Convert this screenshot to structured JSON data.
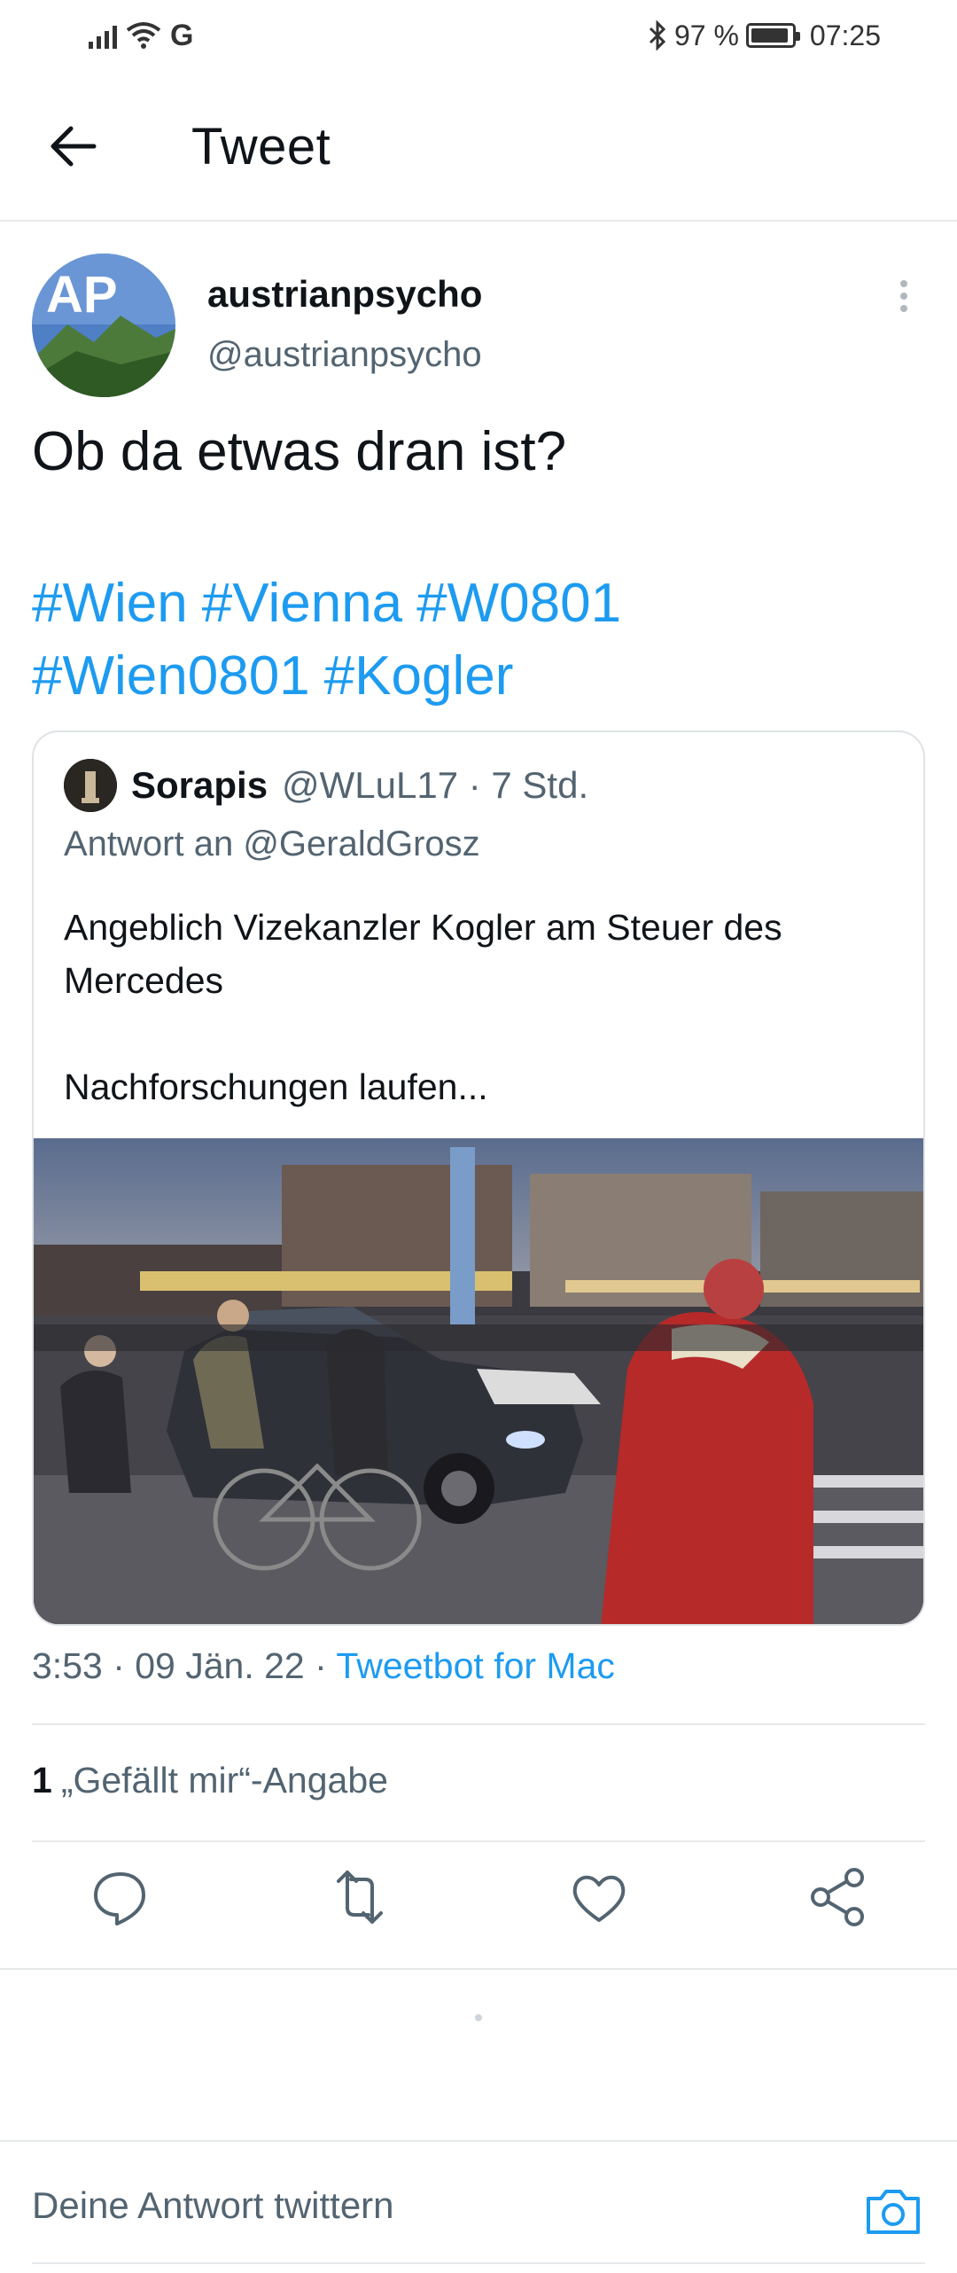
{
  "status_bar": {
    "network": "G",
    "battery_text": "97 %",
    "time": "07:25"
  },
  "header": {
    "title": "Tweet"
  },
  "tweet": {
    "display_name": "austrianpsycho",
    "handle": "@austrianpsycho",
    "avatar_text": "AP",
    "text": "Ob da etwas dran ist?",
    "hashtags": [
      "#Wien",
      "#Vienna",
      "#W0801",
      "#Wien0801",
      "#Kogler"
    ],
    "timestamp": "3:53 · 09 Jän. 22 · ",
    "source": "Tweetbot for Mac",
    "likes_count": "1",
    "likes_label": "„Gefällt mir“-Angabe"
  },
  "quoted_tweet": {
    "display_name": "Sorapis",
    "meta": "@WLuL17 · 7 Std.",
    "reply_to": "Antwort an @GeraldGrosz",
    "text_line1": "Angeblich Vizekanzler Kogler am Steuer des Mercedes",
    "text_line2": "Nachforschungen laufen..."
  },
  "actions": [
    "reply-icon",
    "retweet-icon",
    "like-icon",
    "share-icon"
  ],
  "reply_bar": {
    "placeholder": "Deine Antwort twittern"
  },
  "colors": {
    "accent": "#1d9bf0",
    "secondary_text": "#536471",
    "divider": "#e6e9eb"
  }
}
